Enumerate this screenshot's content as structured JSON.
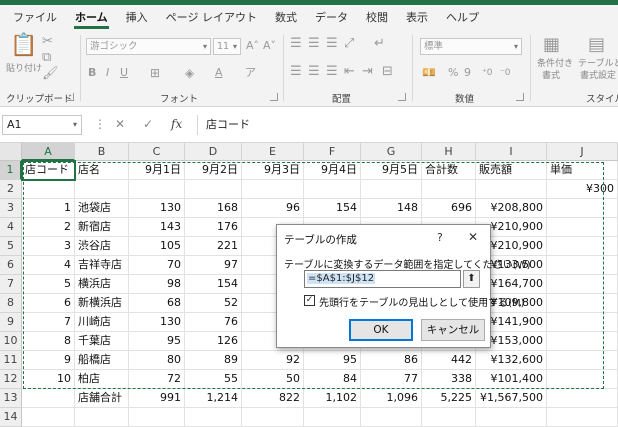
{
  "ribbon": {
    "tabs": [
      "ファイル",
      "ホーム",
      "挿入",
      "ページ レイアウト",
      "数式",
      "データ",
      "校閲",
      "表示",
      "ヘルプ"
    ],
    "active_tab": "ホーム",
    "clipboard": {
      "paste_label": "貼り付け",
      "group_label": "クリップボード"
    },
    "font": {
      "font_name": "游ゴシック",
      "font_size": "11",
      "group_label": "フォント"
    },
    "alignment": {
      "group_label": "配置"
    },
    "number": {
      "format": "標準",
      "group_label": "数値"
    },
    "styles": {
      "conditional_label_1": "条件付き",
      "conditional_label_2": "書式",
      "table_label_1": "テーブルとし",
      "table_label_2": "書式設定",
      "group_label": "スタイル"
    }
  },
  "formula_bar": {
    "name_box": "A1",
    "formula": "店コード",
    "fx": "fx"
  },
  "grid": {
    "columns": [
      "A",
      "B",
      "C",
      "D",
      "E",
      "F",
      "G",
      "H",
      "I",
      "J"
    ],
    "rows": [
      "1",
      "2",
      "3",
      "4",
      "5",
      "6",
      "7",
      "8",
      "9",
      "10",
      "11",
      "12",
      "13",
      "14"
    ],
    "cells": {
      "row1": [
        "店コード",
        "店名",
        "9月1日",
        "9月2日",
        "9月3日",
        "9月4日",
        "9月5日",
        "合計数",
        "販売額",
        "単価"
      ],
      "row2": [
        "",
        "",
        "",
        "",
        "",
        "",
        "",
        "",
        "",
        "¥300"
      ],
      "row3": [
        "1",
        "池袋店",
        "130",
        "168",
        "96",
        "154",
        "148",
        "696",
        "¥208,800",
        ""
      ],
      "row4": [
        "2",
        "新宿店",
        "143",
        "176",
        "",
        "",
        "",
        "",
        "¥210,900",
        ""
      ],
      "row5": [
        "3",
        "渋谷店",
        "105",
        "221",
        "",
        "",
        "",
        "",
        "¥210,900",
        ""
      ],
      "row6": [
        "4",
        "吉祥寺店",
        "70",
        "97",
        "",
        "",
        "",
        "",
        "¥133,500",
        ""
      ],
      "row7": [
        "5",
        "横浜店",
        "98",
        "154",
        "",
        "",
        "",
        "",
        "¥164,700",
        ""
      ],
      "row8": [
        "6",
        "新横浜店",
        "68",
        "52",
        "",
        "",
        "",
        "",
        "¥109,800",
        ""
      ],
      "row9": [
        "7",
        "川崎店",
        "130",
        "76",
        "",
        "",
        "",
        "",
        "¥141,900",
        ""
      ],
      "row10": [
        "8",
        "千葉店",
        "95",
        "126",
        "",
        "",
        "",
        "",
        "¥153,000",
        ""
      ],
      "row11": [
        "9",
        "船橋店",
        "80",
        "89",
        "92",
        "95",
        "86",
        "442",
        "¥132,600",
        ""
      ],
      "row12": [
        "10",
        "柏店",
        "72",
        "55",
        "50",
        "84",
        "77",
        "338",
        "¥101,400",
        ""
      ],
      "row13": [
        "",
        "店舗合計",
        "991",
        "1,214",
        "822",
        "1,102",
        "1,096",
        "5,225",
        "¥1,567,500",
        ""
      ],
      "row14": [
        "",
        "",
        "",
        "",
        "",
        "",
        "",
        "",
        "",
        ""
      ]
    }
  },
  "dialog": {
    "title": "テーブルの作成",
    "help": "?",
    "close": "✕",
    "prompt": "テーブルに変換するデータ範囲を指定してください(W)",
    "range_value": "=$A$1:$J$12",
    "ref_button": "⬆",
    "header_checkbox_label": "先頭行をテーブルの見出しとして使用する(M)",
    "header_checked": true,
    "ok_label": "OK",
    "cancel_label": "キャンセル"
  },
  "colors": {
    "accent": "#217346",
    "selection_border": "#217346",
    "ok_border": "#0078d7"
  }
}
